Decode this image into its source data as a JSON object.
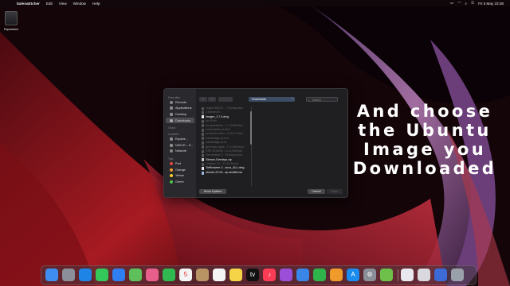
{
  "menubar": {
    "app": "balenaEtcher",
    "menus": [
      "Edit",
      "View",
      "Window",
      "Help"
    ],
    "clock": "Fri 5 May 23:38"
  },
  "desktop": {
    "icon_label": "Expansion"
  },
  "dialog": {
    "sidebar": {
      "favourites_header": "Favourites",
      "favourites": [
        "Recents",
        "Applications",
        "Desktop",
        "Downloads"
      ],
      "icloud_header": "iCloud",
      "locations_header": "Locations",
      "locations": [
        "Expans...",
        "NAS-IE – S...",
        "Network"
      ],
      "tags_header": "Tags",
      "tags": [
        {
          "label": "Red",
          "color": "#e8453c"
        },
        {
          "label": "Orange",
          "color": "#f09a2c"
        },
        {
          "label": "Yellow",
          "color": "#f3d02e"
        },
        {
          "label": "Green",
          "color": "#4fc04a"
        }
      ]
    },
    "location": "Downloads",
    "search_placeholder": "Search",
    "files": [
      {
        "name": "reaper-MAC0....75.dmg-fzsyx",
        "enabled": false,
        "kind": "doc"
      },
      {
        "name": "Channel-ib...",
        "enabled": false,
        "kind": "doc"
      },
      {
        "name": "imager_1.7.4.dmg",
        "enabled": true,
        "kind": "doc"
      },
      {
        "name": "bcl-8.bin",
        "enabled": false,
        "kind": "doc"
      },
      {
        "name": "en-quantiame...7.1.0465.tbz2",
        "enabled": false,
        "kind": "doc"
      },
      {
        "name": "LessonsRecor.tbz2",
        "enabled": false,
        "kind": "doc"
      },
      {
        "name": "pressure-calen...2.30.07.tbz2",
        "enabled": false,
        "kind": "doc"
      },
      {
        "name": "hassimage-pi.3.xz",
        "enabled": false,
        "kind": "doc"
      },
      {
        "name": "hassimage-pi.xz",
        "enabled": false,
        "kind": "doc"
      },
      {
        "name": "generate-upda...7.1.0465.tbz2",
        "enabled": false,
        "kind": "doc"
      },
      {
        "name": "ESP-SOUND...0.0.4298.tbz2",
        "enabled": false,
        "kind": "doc"
      },
      {
        "name": "Screenshot 2...75.dmg-cloud",
        "enabled": false,
        "kind": "doc"
      },
      {
        "name": "Stream-Overlays.zip",
        "enabled": true,
        "kind": "zip"
      },
      {
        "name": "Unisync-Tn...11.43.36.pdf",
        "enabled": false,
        "kind": "doc"
      },
      {
        "name": "TorBrowser-1...acos_ALL.dmg",
        "enabled": true,
        "kind": "doc"
      },
      {
        "name": "ubuntu-22.04...op-amd64.iso",
        "enabled": true,
        "kind": "img"
      }
    ],
    "show_options": "Show Options",
    "cancel": "Cancel",
    "open": "Open"
  },
  "caption": {
    "lines": [
      "And choose",
      "the Ubuntu",
      "Image you",
      "Downloaded"
    ]
  },
  "dock": {
    "apps": [
      {
        "name": "Finder",
        "color": "#3d8ef0",
        "glyph": ""
      },
      {
        "name": "Launchpad",
        "color": "#8a8f99",
        "glyph": ""
      },
      {
        "name": "Safari",
        "color": "#1e84e6",
        "glyph": ""
      },
      {
        "name": "Messages",
        "color": "#34c759",
        "glyph": ""
      },
      {
        "name": "Mail",
        "color": "#2f7ef2",
        "glyph": ""
      },
      {
        "name": "Maps",
        "color": "#5fbf5a",
        "glyph": ""
      },
      {
        "name": "Photos",
        "color": "#e95f8c",
        "glyph": ""
      },
      {
        "name": "FaceTime",
        "color": "#30b950",
        "glyph": ""
      },
      {
        "name": "Calendar",
        "color": "#f4f4f4",
        "glyph": "5"
      },
      {
        "name": "Contacts",
        "color": "#b89464",
        "glyph": ""
      },
      {
        "name": "Reminders",
        "color": "#f4f4f4",
        "glyph": ""
      },
      {
        "name": "Notes",
        "color": "#f5d547",
        "glyph": ""
      },
      {
        "name": "TV",
        "color": "#111111",
        "glyph": "tv"
      },
      {
        "name": "Music",
        "color": "#fa3c55",
        "glyph": "♪"
      },
      {
        "name": "Podcasts",
        "color": "#9b4fd8",
        "glyph": ""
      },
      {
        "name": "Keynote",
        "color": "#3a86e8",
        "glyph": ""
      },
      {
        "name": "Numbers",
        "color": "#2fb34b",
        "glyph": ""
      },
      {
        "name": "Pages",
        "color": "#f09a2c",
        "glyph": ""
      },
      {
        "name": "App Store",
        "color": "#1a8cf0",
        "glyph": "A"
      },
      {
        "name": "System Settings",
        "color": "#8a8f99",
        "glyph": "⚙"
      },
      {
        "name": "balenaEtcher",
        "color": "#6fc04a",
        "glyph": ""
      },
      {
        "name": "Document",
        "color": "#e8e8ee",
        "glyph": ""
      },
      {
        "name": "Stack",
        "color": "#d8d8de",
        "glyph": ""
      },
      {
        "name": "Downloads stack",
        "color": "#3c6bd8",
        "glyph": ""
      },
      {
        "name": "Trash",
        "color": "#9aa0aa",
        "glyph": ""
      }
    ]
  }
}
